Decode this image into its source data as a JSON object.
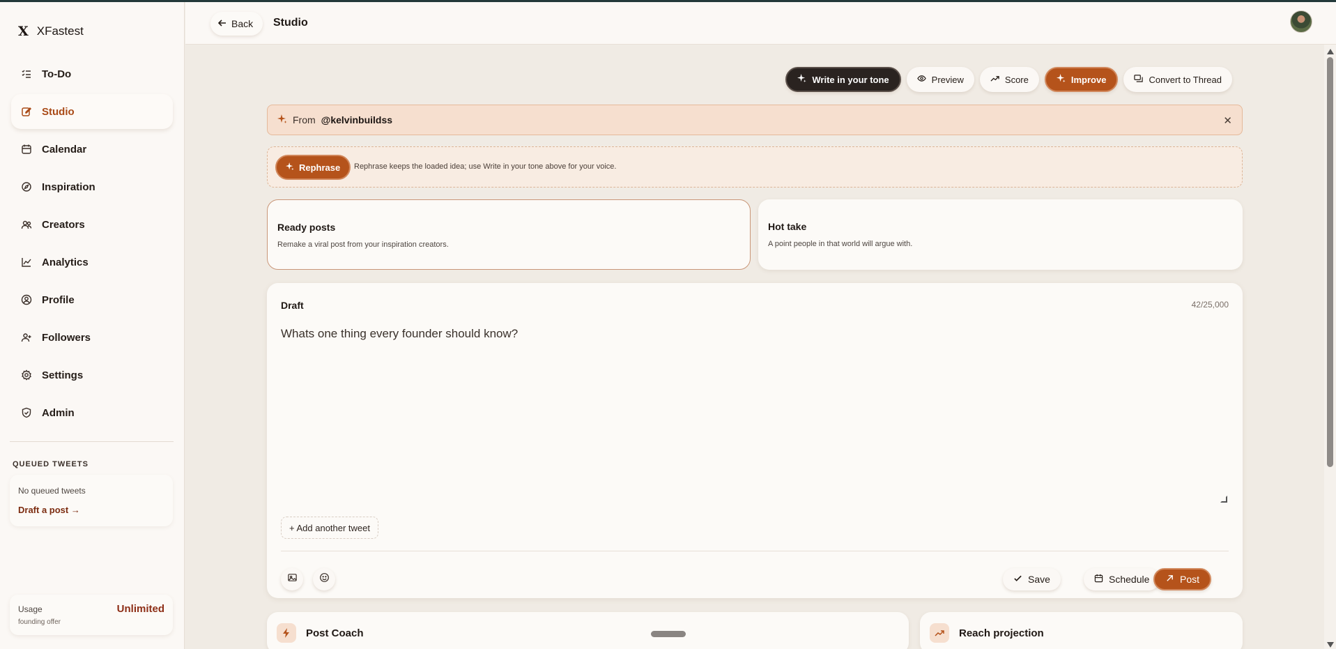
{
  "brand": {
    "logo": "X",
    "name": "XFastest"
  },
  "sidebar": {
    "items": [
      {
        "label": "To-Do",
        "icon": "list-check-icon"
      },
      {
        "label": "Studio",
        "icon": "edit-icon",
        "active": true
      },
      {
        "label": "Calendar",
        "icon": "calendar-icon"
      },
      {
        "label": "Inspiration",
        "icon": "compass-icon"
      },
      {
        "label": "Creators",
        "icon": "users-icon"
      },
      {
        "label": "Analytics",
        "icon": "chart-line-icon"
      },
      {
        "label": "Profile",
        "icon": "user-circle-icon"
      },
      {
        "label": "Followers",
        "icon": "user-plus-icon"
      },
      {
        "label": "Settings",
        "icon": "gear-icon"
      },
      {
        "label": "Admin",
        "icon": "shield-icon"
      }
    ],
    "queued": {
      "title": "QUEUED TWEETS",
      "empty": "No queued tweets",
      "link": "Draft a post →"
    },
    "usage": {
      "label": "Usage",
      "sub": "founding offer",
      "value": "Unlimited"
    }
  },
  "header": {
    "back": "Back",
    "title": "Studio"
  },
  "toolbar": {
    "write_tone": "Write in your tone",
    "preview": "Preview",
    "score": "Score",
    "improve": "Improve",
    "convert": "Convert to Thread"
  },
  "from_banner": {
    "prefix": "From",
    "handle": "@kelvinbuildss"
  },
  "rephrase": {
    "button": "Rephrase",
    "hint": "Rephrase keeps the loaded idea; use Write in your tone above for your voice."
  },
  "modes": [
    {
      "title": "Ready posts",
      "desc": "Remake a viral post from your inspiration creators."
    },
    {
      "title": "Hot take",
      "desc": "A point people in that world will argue with."
    }
  ],
  "draft": {
    "label": "Draft",
    "count": "42/25,000",
    "text": "Whats one thing every founder should know?",
    "add_tweet": "+ Add another tweet",
    "save": "Save",
    "schedule": "Schedule",
    "post": "Post"
  },
  "bottom": {
    "coach": "Post Coach",
    "reach": "Reach projection"
  },
  "colors": {
    "accent": "#b5531b",
    "dark": "#2a2320",
    "banner": "#f6dfcf",
    "active_nav": "#a94a17"
  }
}
